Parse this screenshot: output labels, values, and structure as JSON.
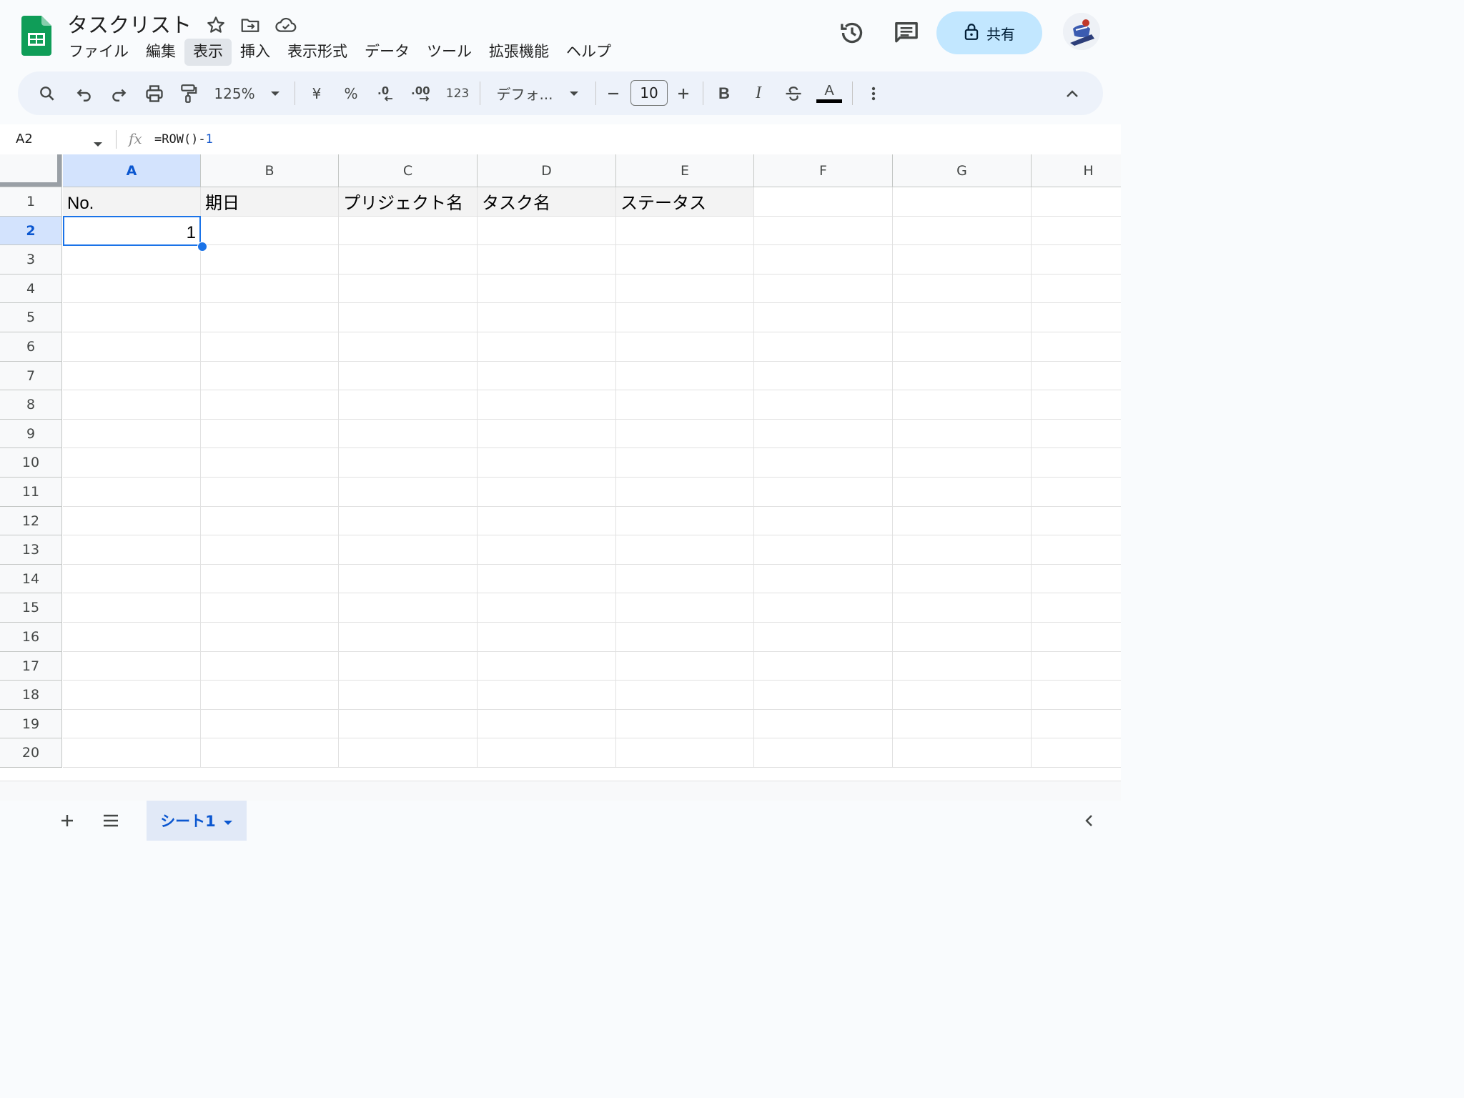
{
  "app": {
    "doc_title": "タスクリスト",
    "logo_icon": "google-sheets-icon",
    "menu": [
      "ファイル",
      "編集",
      "表示",
      "挿入",
      "表示形式",
      "データ",
      "ツール",
      "拡張機能",
      "ヘルプ"
    ],
    "active_menu": "表示",
    "share_label": "共有"
  },
  "toolbar": {
    "zoom": "125%",
    "currency": "¥",
    "percent": "%",
    "number_format": "123",
    "font": "デフォ...",
    "font_size": "10",
    "bold": "B",
    "italic": "I",
    "text_color_label": "A"
  },
  "formula_bar": {
    "name_box": "A2",
    "fx": "fx",
    "formula_prefix": "=ROW()-",
    "formula_number": "1"
  },
  "grid": {
    "columns": [
      "A",
      "B",
      "C",
      "D",
      "E",
      "F",
      "G",
      "H"
    ],
    "selected_column": "A",
    "rows": [
      "1",
      "2",
      "3",
      "4",
      "5",
      "6",
      "7",
      "8",
      "9",
      "10",
      "11",
      "12",
      "13",
      "14",
      "15",
      "16",
      "17",
      "18",
      "19",
      "20"
    ],
    "selected_row": "2",
    "row1": [
      "No.",
      "期日",
      "プリジェクト名",
      "タスク名",
      "ステータス"
    ],
    "a2": "1"
  },
  "sheets": {
    "active": "シート1"
  },
  "colors": {
    "accent": "#1a73e8",
    "share_bg": "#c2e7ff",
    "header_selected": "#d3e3fd",
    "sheets_green": "#0f9d58"
  }
}
